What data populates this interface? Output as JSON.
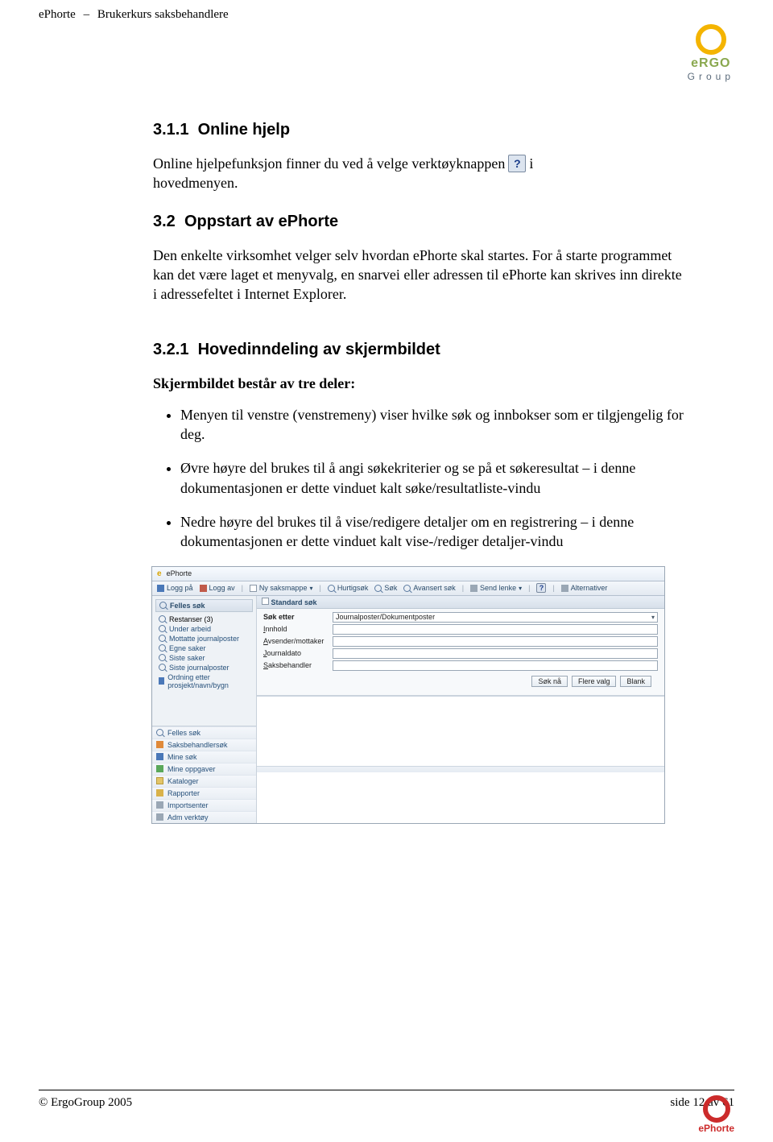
{
  "header": {
    "product": "ePhorte",
    "subtitle": "Brukerkurs saksbehandlere"
  },
  "logo_top": {
    "line1": "eRGO",
    "line2": "Group"
  },
  "section1": {
    "number": "3.1.1",
    "title": "Online hjelp",
    "p1a": "Online hjelpefunksjon finner du ved å velge verktøyknappen",
    "p1b": "i",
    "p1c": "hovedmenyen.",
    "help_glyph": "?"
  },
  "section2": {
    "number": "3.2",
    "title": "Oppstart av ePhorte",
    "p": "Den enkelte virksomhet velger selv hvordan ePhorte skal startes. For å starte programmet kan det være laget et menyvalg, en snarvei eller adressen til ePhorte kan skrives inn direkte i adressefeltet i Internet Explorer."
  },
  "section3": {
    "number": "3.2.1",
    "title": "Hovedinndeling av skjermbildet",
    "lead": "Skjermbildet består av tre deler:",
    "bullets": [
      "Menyen til venstre (venstremeny) viser hvilke søk og innbokser som er tilgjengelig for deg.",
      "Øvre høyre del brukes til å angi søkekriterier og se på et søkeresultat – i denne dokumentasjonen er dette vinduet kalt søke/resultatliste-vindu",
      "Nedre høyre del brukes til å vise/redigere detaljer om en registrering – i denne dokumentasjonen er dette vinduet kalt vise-/rediger detaljer-vindu"
    ]
  },
  "screenshot": {
    "title": "ePhorte",
    "toolbar": {
      "logon": "Logg på",
      "logoff": "Logg av",
      "newcase": "Ny saksmappe",
      "quick": "Hurtigsøk",
      "search": "Søk",
      "advsearch": "Avansert søk",
      "sendlink": "Send lenke",
      "options": "Alternativer"
    },
    "left": {
      "header": "Felles søk",
      "tree": [
        "Restanser (3)",
        "Under arbeid",
        "Mottatte journalposter",
        "Egne saker",
        "Siste saker",
        "Siste journalposter",
        "Ordning etter prosjekt/navn/bygn"
      ],
      "bottom": [
        "Felles søk",
        "Saksbehandlersøk",
        "Mine søk",
        "Mine oppgaver",
        "Kataloger",
        "Rapporter",
        "Importsenter",
        "Adm verktøy"
      ]
    },
    "right": {
      "header": "Standard søk",
      "search_label": "Søk etter",
      "search_value": "Journalposter/Dokumentposter",
      "rows": [
        {
          "label_pre": "I",
          "label_rest": "nnhold"
        },
        {
          "label_pre": "A",
          "label_rest": "vsender/mottaker"
        },
        {
          "label_pre": "J",
          "label_rest": "ournaldato"
        },
        {
          "label_pre": "S",
          "label_rest": "aksbehandler"
        }
      ],
      "buttons": {
        "searchnow": "Søk nå",
        "more": "Flere valg",
        "blank": "Blank"
      }
    }
  },
  "footer": {
    "left": "© ErgoGroup 2005",
    "right": "side 12 av 61"
  },
  "logo_bottom": {
    "text": "ePhorte"
  }
}
